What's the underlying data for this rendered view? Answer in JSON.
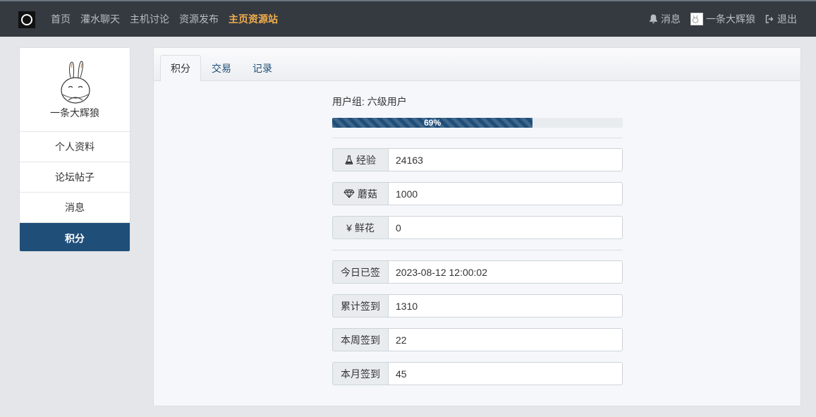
{
  "nav": {
    "links": [
      "首页",
      "灌水聊天",
      "主机讨论",
      "资源发布",
      "主页资源站"
    ],
    "active_index": 4,
    "messages_label": "消息",
    "username": "一条大辉狼",
    "logout_label": "退出"
  },
  "sidebar": {
    "profile_name": "一条大辉狼",
    "items": [
      {
        "label": "个人资料"
      },
      {
        "label": "论坛帖子"
      },
      {
        "label": "消息"
      },
      {
        "label": "积分"
      }
    ],
    "active_index": 3
  },
  "tabs": [
    "积分",
    "交易",
    "记录"
  ],
  "active_tab": 0,
  "points": {
    "group_line": "用户组: 六级用户",
    "progress_percent": 69,
    "progress_label": "69%",
    "stats": [
      {
        "icon": "flask-icon",
        "label": "经验",
        "value": "24163"
      },
      {
        "icon": "diamond-icon",
        "label": "蘑菇",
        "value": "1000"
      },
      {
        "icon": "yen-icon",
        "label": "鲜花",
        "value": "0"
      }
    ],
    "signin": [
      {
        "label": "今日已签",
        "value": "2023-08-12 12:00:02"
      },
      {
        "label": "累计签到",
        "value": "1310"
      },
      {
        "label": "本周签到",
        "value": "22"
      },
      {
        "label": "本月签到",
        "value": "45"
      }
    ]
  },
  "colors": {
    "navbar_bg": "#343a40",
    "accent": "#1f4e79",
    "active_nav": "#f0ad4e"
  }
}
